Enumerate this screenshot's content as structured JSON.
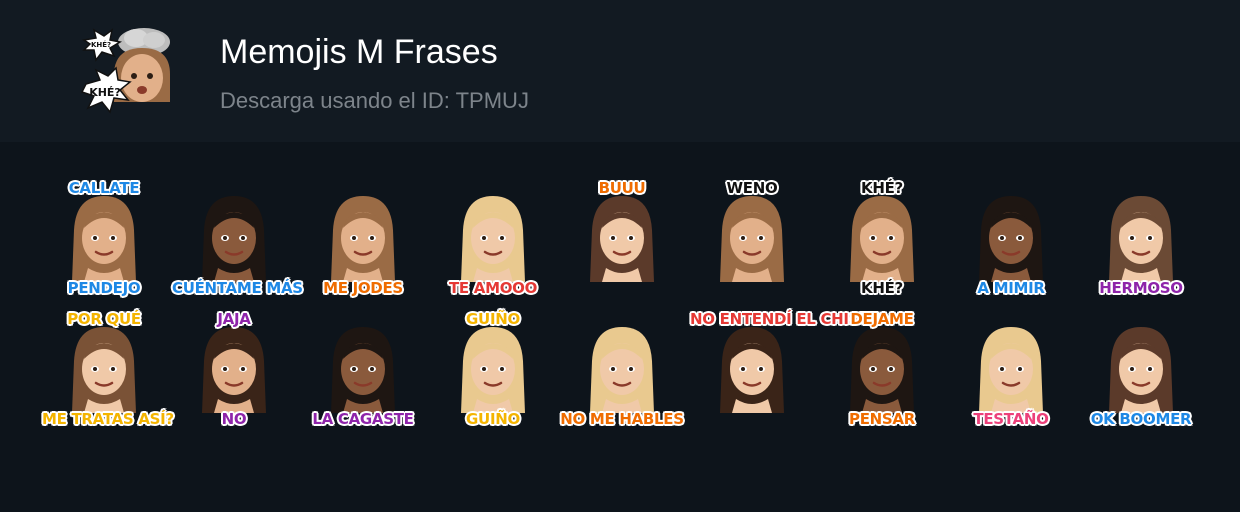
{
  "pack": {
    "title": "Memojis M Frases",
    "subtitle": "Descarga usando el ID: TPMUJ",
    "icon_label_top": "KHÉ?",
    "icon_label_bottom": "KHÉ?"
  },
  "stickers": [
    {
      "top": "CALLATE",
      "bottom": "PENDEJO",
      "color": "#1e88e5",
      "skin": "#e2b08a",
      "hair": "#9a6b45"
    },
    {
      "top": "",
      "bottom": "CUÉNTAME MÁS",
      "color": "#1e88e5",
      "skin": "#8a5a3c",
      "hair": "#1e1612"
    },
    {
      "top": "",
      "bottom": "ME JODES",
      "color": "#ef6c00",
      "skin": "#e2b08a",
      "hair": "#9a6b45"
    },
    {
      "top": "",
      "bottom": "TE AMOOO",
      "color": "#e53935",
      "skin": "#f0c9a8",
      "hair": "#e9c98f"
    },
    {
      "top": "BUUU",
      "bottom": "",
      "color": "#ef6c00",
      "skin": "#f0c9a8",
      "hair": "#5b3a2a"
    },
    {
      "top": "WENO",
      "bottom": "",
      "color": "#111111",
      "skin": "#e2b08a",
      "hair": "#9a6b45"
    },
    {
      "top": "KHÉ?",
      "bottom": "KHÉ?",
      "color": "#111111",
      "skin": "#e2b08a",
      "hair": "#9a6b45"
    },
    {
      "top": "",
      "bottom": "A MIMIR",
      "color": "#1e88e5",
      "skin": "#8a5a3c",
      "hair": "#1e1612"
    },
    {
      "top": "",
      "bottom": "HERMOSO",
      "color": "#8e24aa",
      "skin": "#f0c9a8",
      "hair": "#6b4a35"
    },
    {
      "top": "POR QUÉ",
      "bottom": "ME TRATAS ASÍ?",
      "color": "#f4b400",
      "skin": "#f0c9a8",
      "hair": "#7a5236"
    },
    {
      "top": "JAJA",
      "bottom": "NO",
      "color": "#8e24aa",
      "skin": "#e2b08a",
      "hair": "#3a2418"
    },
    {
      "top": "",
      "bottom": "LA CAGASTE",
      "color": "#8e24aa",
      "skin": "#8a5a3c",
      "hair": "#1e1612"
    },
    {
      "top": "GUIÑO",
      "bottom": "GUIÑO",
      "color": "#f4b400",
      "skin": "#f0c9a8",
      "hair": "#e9c98f"
    },
    {
      "top": "",
      "bottom": "NO ME HABLES",
      "color": "#ef6c00",
      "skin": "#f0c9a8",
      "hair": "#e9c98f"
    },
    {
      "top": "NO ENTENDÍ EL CHISTE",
      "bottom": "",
      "color": "#e53935",
      "skin": "#f0c9a8",
      "hair": "#3a2418"
    },
    {
      "top": "DEJAME",
      "bottom": "PENSAR",
      "color": "#ef6c00",
      "skin": "#8a5a3c",
      "hair": "#1e1612"
    },
    {
      "top": "",
      "bottom": "TESTAÑO",
      "color": "#ec407a",
      "skin": "#f0c9a8",
      "hair": "#e9c98f"
    },
    {
      "top": "",
      "bottom": "OK BOOMER",
      "color": "#1e88e5",
      "skin": "#f0c9a8",
      "hair": "#5b3a2a"
    }
  ]
}
